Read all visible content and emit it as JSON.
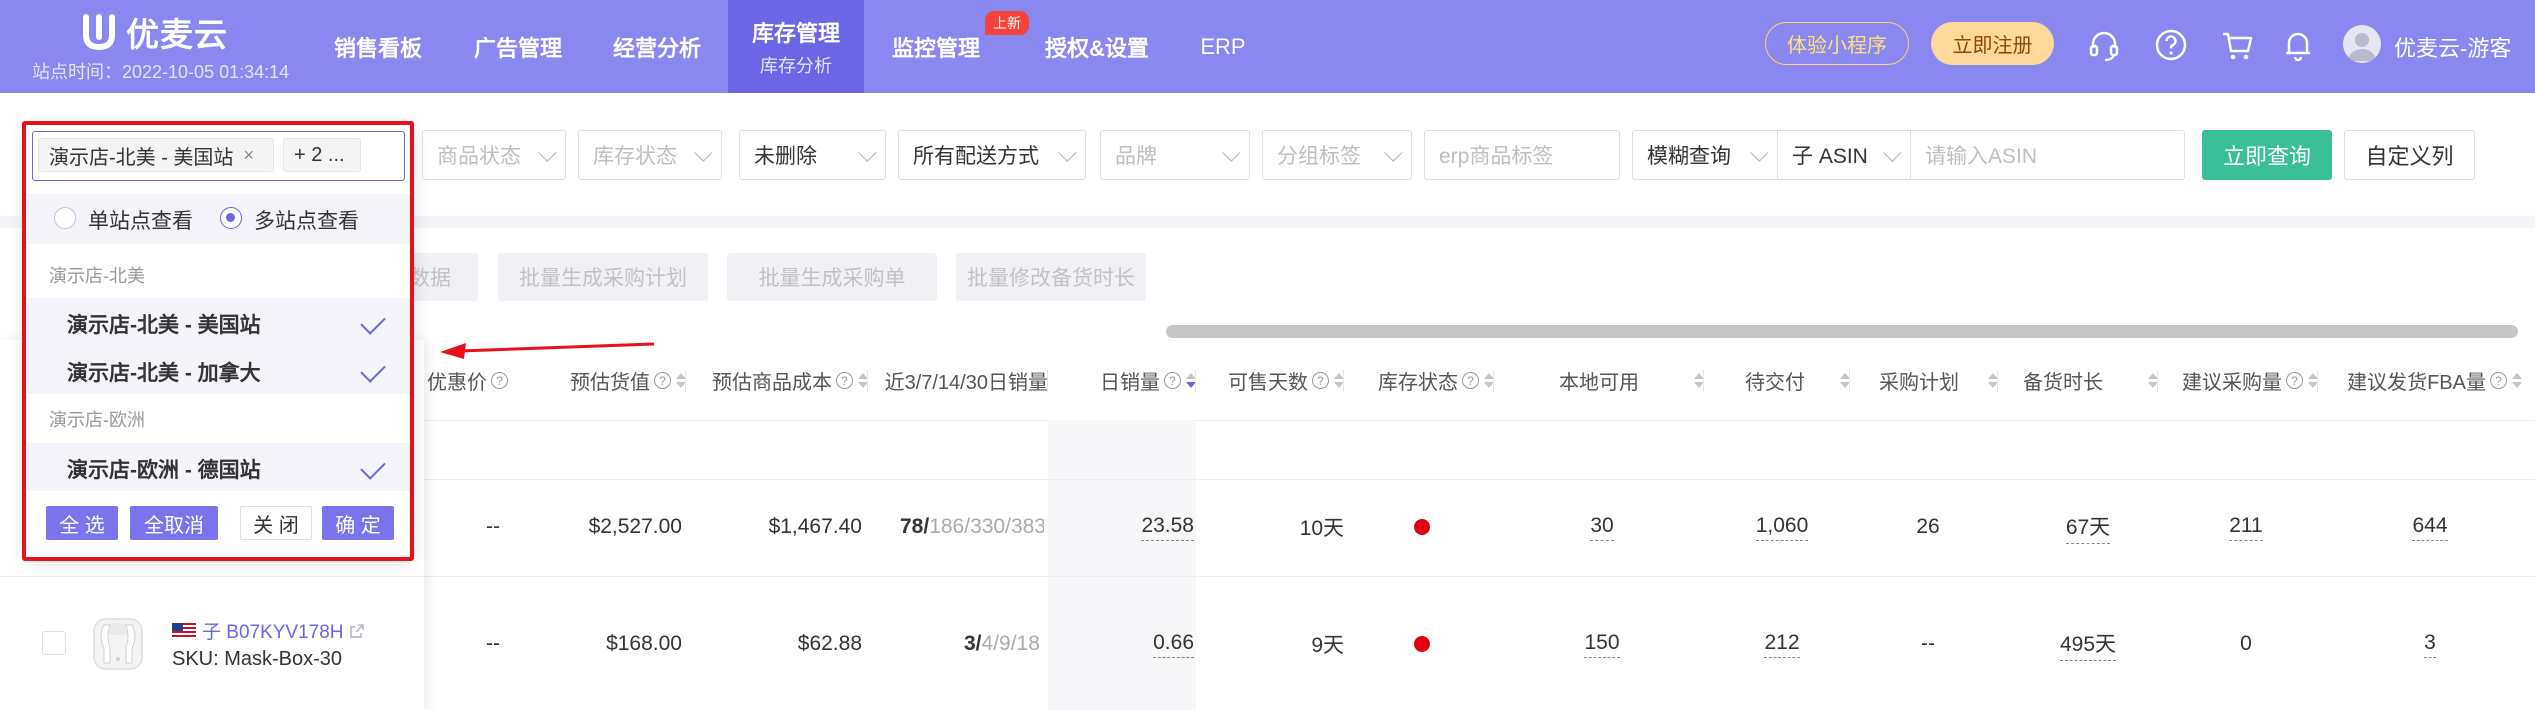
{
  "nav": {
    "brand": "优麦云",
    "site_time": "站点时间：2022-10-05 01:34:14",
    "items": [
      {
        "label": "销售看板"
      },
      {
        "label": "广告管理"
      },
      {
        "label": "经营分析"
      },
      {
        "label": "库存管理",
        "sub": "库存分析",
        "active": true
      },
      {
        "label": "监控管理"
      },
      {
        "label": "授权&设置"
      },
      {
        "label": "ERP"
      }
    ],
    "badge": "上新",
    "mini_program": "体验小程序",
    "register": "立即注册",
    "user": "优麦云-游客",
    "icons": [
      "headset-icon",
      "help-icon",
      "cart-icon",
      "bell-icon",
      "avatar-icon"
    ]
  },
  "filters": {
    "product_status": "商品状态",
    "stock_status": "库存状态",
    "deleted": "未删除",
    "delivery": "所有配送方式",
    "brand": "品牌",
    "group_tag": "分组标签",
    "erp_tag_placeholder": "erp商品标签",
    "query_mode": "模糊查询",
    "asin_type": "子 ASIN",
    "asin_placeholder": "请输入ASIN",
    "query_button": "立即查询",
    "custom_columns": "自定义列"
  },
  "actions": [
    "数据",
    "批量生成采购计划",
    "批量生成采购单",
    "批量修改备货时长"
  ],
  "store_select": {
    "tags": [
      "演示店-北美 - 美国站",
      "+ 2 ..."
    ],
    "modes": [
      "单站点查看",
      "多站点查看"
    ],
    "selected_mode": "多站点查看",
    "groups": [
      {
        "name": "演示店-北美",
        "options": [
          "演示店-北美 - 美国站",
          "演示店-北美 - 加拿大"
        ]
      },
      {
        "name": "演示店-欧洲",
        "options": [
          "演示店-欧洲 - 德国站"
        ]
      }
    ],
    "buttons": {
      "select_all": "全 选",
      "deselect_all": "全取消",
      "close": "关 闭",
      "confirm": "确 定"
    }
  },
  "table": {
    "columns": [
      "优惠价",
      "预估货值",
      "预估商品成本",
      "近3/7/14/30日销量",
      "日销量",
      "可售天数",
      "库存状态",
      "本地可用",
      "待交付",
      "采购计划",
      "备货时长",
      "建议采购量",
      "建议发货FBA量"
    ],
    "rows": [
      {
        "discount": "--",
        "value": "$2,527.00",
        "cost": "$1,467.40",
        "sales_bold": "78/",
        "sales_rest": "186/330/383",
        "daily": "23.58",
        "days": "10天",
        "local": "30",
        "pending": "1,060",
        "plan": "26",
        "lead": "67天",
        "suggest_buy": "211",
        "suggest_fba": "644"
      },
      {
        "discount": "--",
        "value": "$168.00",
        "cost": "$62.88",
        "sales_bold": "3/",
        "sales_rest": "4/9/18",
        "daily": "0.66",
        "days": "9天",
        "local": "150",
        "pending": "212",
        "plan": "--",
        "lead": "495天",
        "suggest_buy": "0",
        "suggest_fba": "3"
      }
    ],
    "product": {
      "asin": "子 B07KYV178H",
      "sku": "SKU: Mask-Box-30"
    }
  },
  "colors": {
    "nav_bg": "#8b87f0",
    "accent": "#6c66e6",
    "query_green": "#3bbf99",
    "highlight_red": "#e8101a",
    "status_red": "#e00012"
  }
}
